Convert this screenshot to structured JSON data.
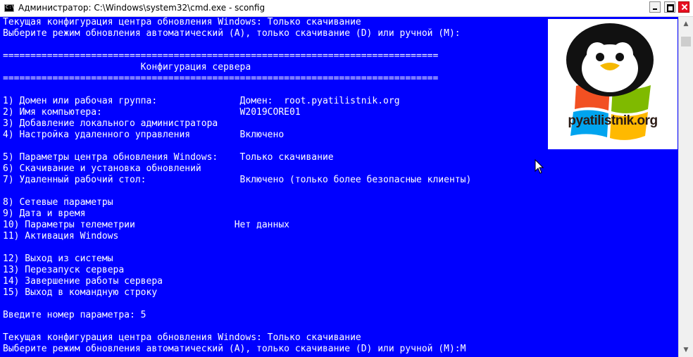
{
  "window": {
    "title": "Администратор: C:\\Windows\\system32\\cmd.exe - sconfig",
    "app_icon": "cmd-icon"
  },
  "console": {
    "lines": [
      "Текущая конфигурация центра обновления Windows: Только скачивание",
      "Выберите режим обновления автоматический (A), только скачивание (D) или ручной (M):",
      "",
      "===============================================================================",
      "                         Конфигурация сервера",
      "===============================================================================",
      "",
      "1) Домен или рабочая группа:               Домен:  root.pyatilistnik.org",
      "2) Имя компьютера:                         W2019CORE01",
      "3) Добавление локального администратора",
      "4) Настройка удаленного управления         Включено",
      "",
      "5) Параметры центра обновления Windows:    Только скачивание",
      "6) Скачивание и установка обновлений",
      "7) Удаленный рабочий стол:                 Включено (только более безопасные клиенты)",
      "",
      "8) Сетевые параметры",
      "9) Дата и время",
      "10) Параметры телеметрии                  Нет данных",
      "11) Активация Windows",
      "",
      "12) Выход из системы",
      "13) Перезапуск сервера",
      "14) Завершение работы сервера",
      "15) Выход в командную строку",
      "",
      "Введите номер параметра: 5",
      "",
      "Текущая конфигурация центра обновления Windows: Только скачивание",
      "Выберите режим обновления автоматический (A), только скачивание (D) или ручной (M):M"
    ]
  },
  "logo": {
    "text": "pyatilistnik.org",
    "icon": "penguin-windows-logo-icon"
  },
  "colors": {
    "console_bg": "#0000ff",
    "console_fg": "#ffffff"
  }
}
